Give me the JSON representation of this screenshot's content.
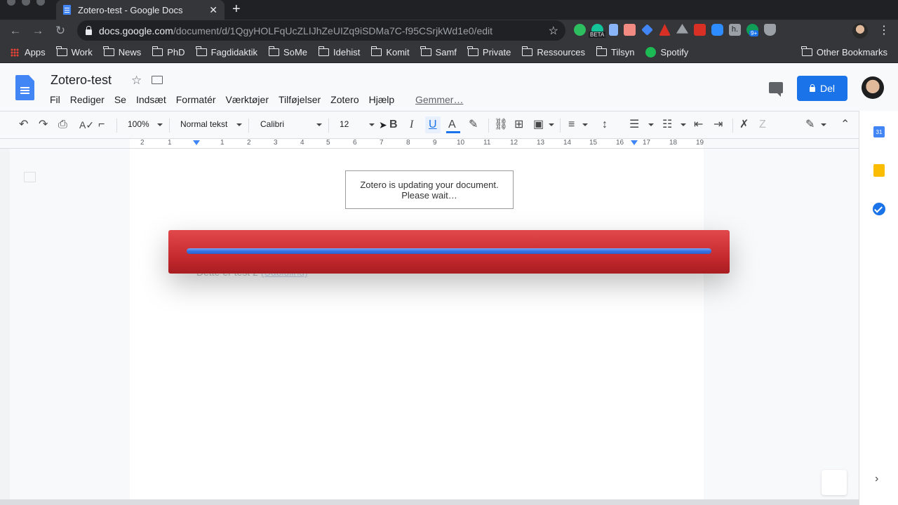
{
  "browser": {
    "tab_title": "Zotero-test - Google Docs",
    "tab_close": "✕",
    "new_tab": "+",
    "url_host": "docs.google.com",
    "url_path": "/document/d/1QgyHOLFqUcZLIJhZeUIZq9iSDMa7C-f95CSrjkWd1e0/edit",
    "ext_badge_beta": "BETA",
    "ext_badge_count": "9+",
    "bookmarks": [
      "Work",
      "News",
      "PhD",
      "Fagdidaktik",
      "SoMe",
      "Idehist",
      "Komit",
      "Samf",
      "Private",
      "Ressources",
      "Tilsyn"
    ],
    "apps_label": "Apps",
    "spotify_label": "Spotify",
    "other_bookmarks": "Other Bookmarks"
  },
  "docs": {
    "title": "Zotero-test",
    "menu": [
      "Fil",
      "Rediger",
      "Se",
      "Indsæt",
      "Formatér",
      "Værktøjer",
      "Tilføjelser",
      "Zotero",
      "Hjælp"
    ],
    "saving_status": "Gemmer…",
    "share_label": "Del",
    "zoom": "100%",
    "style": "Normal tekst",
    "font": "Calibri",
    "font_size": "12",
    "ruler_numbers": [
      "2",
      "1",
      "1",
      "2",
      "3",
      "4",
      "5",
      "6",
      "7",
      "8",
      "9",
      "10",
      "11",
      "12",
      "13",
      "14",
      "15",
      "16",
      "17",
      "18",
      "19"
    ],
    "calendar_day": "31"
  },
  "zotero": {
    "message_line1": "Zotero is updating your document.",
    "message_line2": "Please wait…",
    "progress": 1.0
  },
  "document": {
    "ghost_text": "Dette er test 2",
    "ghost_link": "(Subluiinu)"
  },
  "colors": {
    "accent": "#1a73e8",
    "progress_bar": "#3b78e7",
    "progress_shell": "#c72b2f",
    "browser_dark": "#35363a"
  }
}
